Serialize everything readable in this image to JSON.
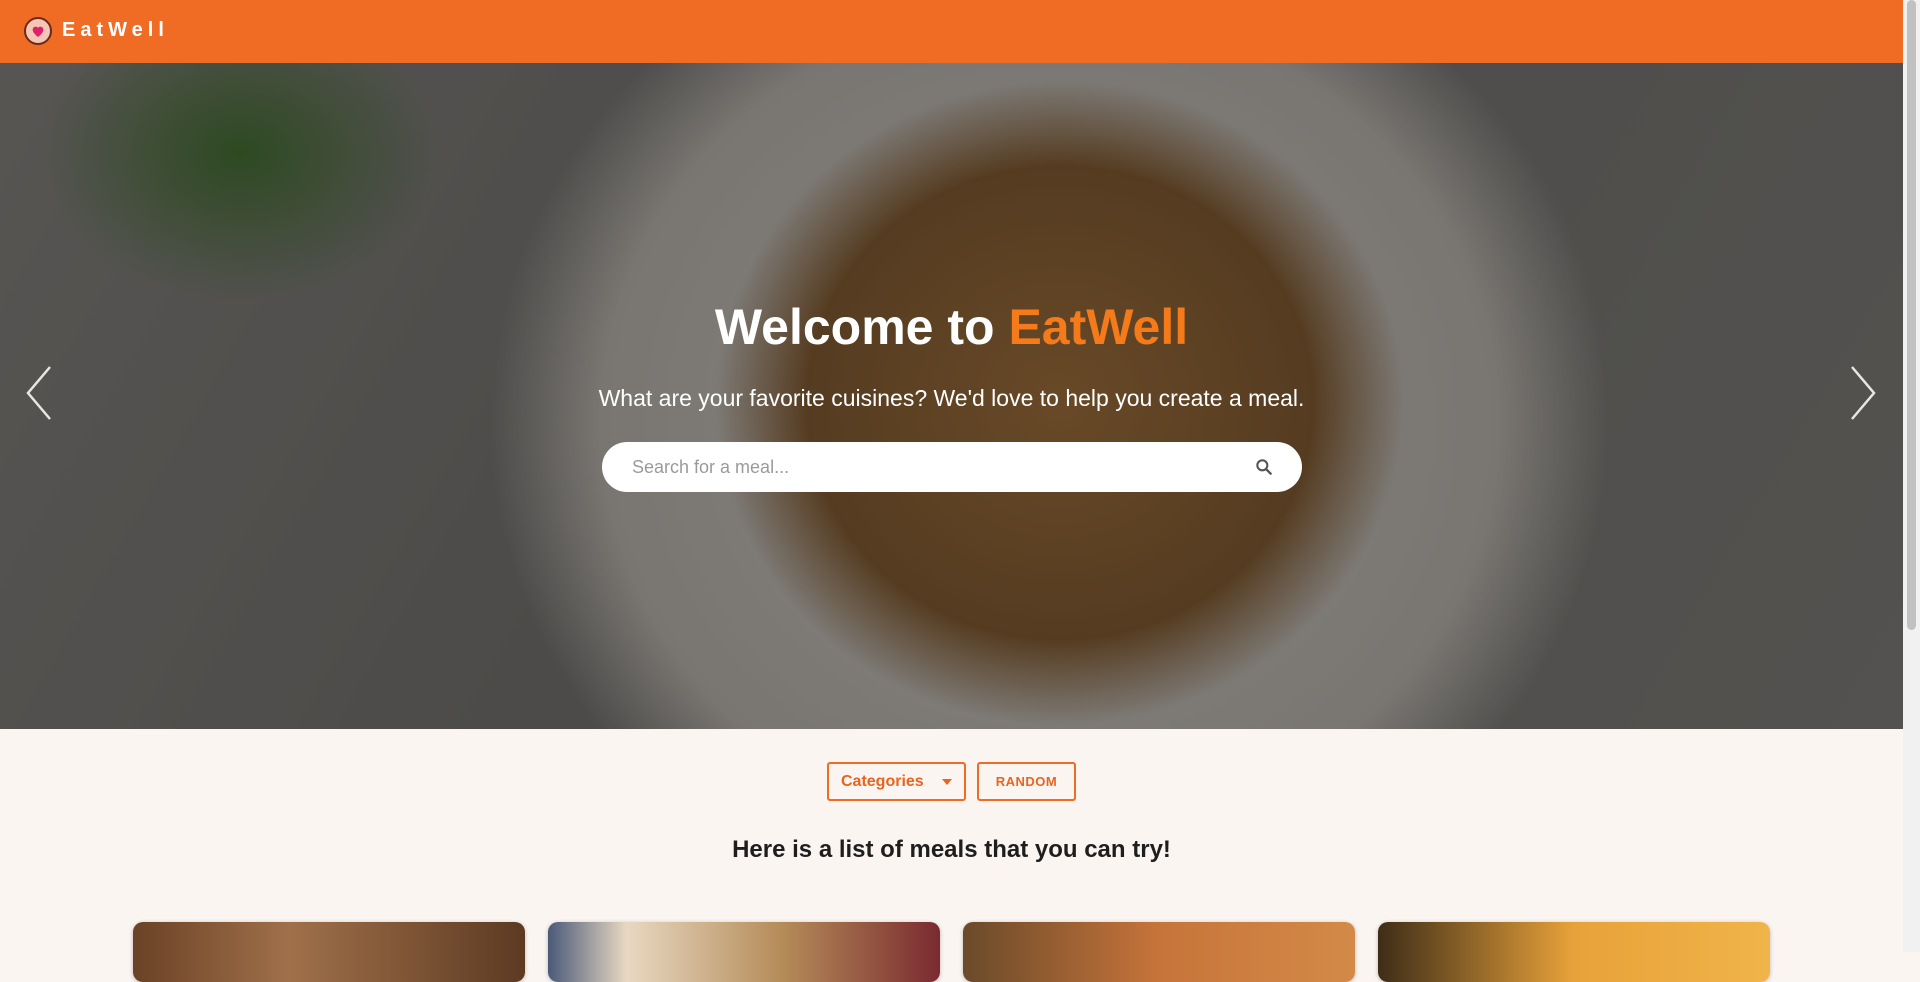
{
  "header": {
    "brand": "EatWell",
    "logo_icon": "heart-icon",
    "color": "#f06b24"
  },
  "hero": {
    "title_prefix": "Welcome to ",
    "title_accent": "EatWell",
    "subtitle": "What are your favorite cuisines? We'd love to help you create a meal.",
    "search": {
      "placeholder": "Search for a meal...",
      "value": ""
    },
    "accent_color": "#f47a1a"
  },
  "controls": {
    "categories_label": "Categories",
    "random_label": "RANDOM"
  },
  "list": {
    "title": "Here is a list of meals that you can try!"
  },
  "meal_cards": [
    {
      "image": "meal-image-1"
    },
    {
      "image": "meal-image-2"
    },
    {
      "image": "meal-image-3"
    },
    {
      "image": "meal-image-4"
    }
  ]
}
